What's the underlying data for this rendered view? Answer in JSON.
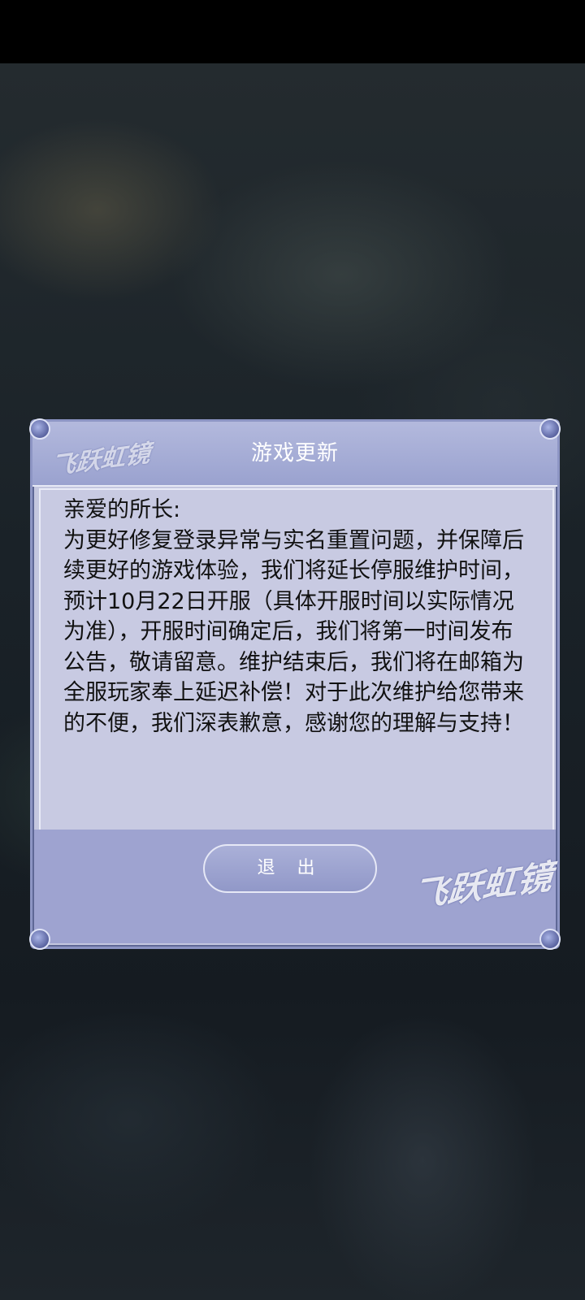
{
  "dialog": {
    "title": "游戏更新",
    "greeting": "亲爱的所长:",
    "message": "为更好修复登录异常与实名重置问题，并保障后续更好的游戏体验，我们将延长停服维护时间，预计10月22日开服（具体开服时间以实际情况为准），开服时间确定后，我们将第一时间发布公告，敬请留意。维护结束后，我们将在邮箱为全服玩家奉上延迟补偿！对于此次维护给您带来的不便，我们深表歉意，感谢您的理解与支持！",
    "exit_label": "退 出",
    "logo_text": "飞跃虹镜"
  },
  "colors": {
    "panel": "#c4c7df",
    "header": "#9aa2cf",
    "footer": "#9ea3d0",
    "border": "#8d95c4"
  }
}
